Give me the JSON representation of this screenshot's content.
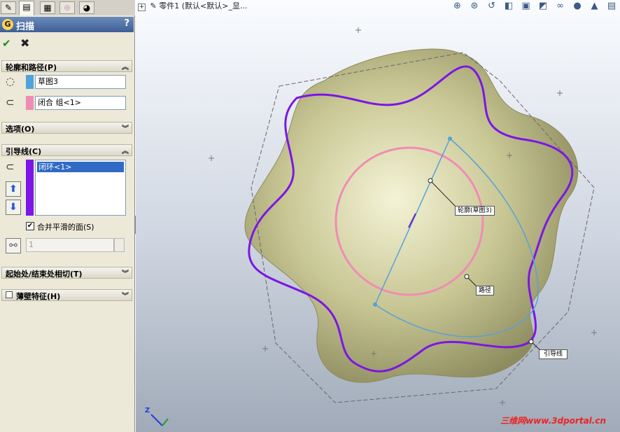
{
  "pm_tabs": [
    {
      "name": "feature-manager-icon",
      "glyph": "✎"
    },
    {
      "name": "property-manager-icon",
      "glyph": "▤"
    },
    {
      "name": "configuration-manager-icon",
      "glyph": "▦"
    },
    {
      "name": "dimxpert-icon",
      "glyph": "⊕"
    },
    {
      "name": "display-manager-icon",
      "glyph": "◕"
    }
  ],
  "feature": {
    "title": "扫描",
    "help": "?",
    "ok": "✔",
    "cancel": "✖"
  },
  "profile_path": {
    "header": "轮廓和路径(P)",
    "profile_value": "草图3",
    "path_value": "闭合 组<1>",
    "profile_color": "#4fa3dc",
    "path_color": "#f08cb4"
  },
  "options": {
    "header": "选项(O)"
  },
  "guides": {
    "header": "引导线(C)",
    "items": [
      "闭环<1>"
    ],
    "color": "#7b16e6",
    "merge_label": "合并平滑的面(S)",
    "merge_checked": true,
    "spin_value": "1"
  },
  "tangency": {
    "header": "起始处/结束处相切(T)"
  },
  "thin": {
    "header": "薄壁特征(H)"
  },
  "graphics": {
    "tree_label": "零件1   (默认<默认>_显...",
    "callouts": {
      "profile": "轮廓(草图3)",
      "path": "路径",
      "guide": "引导线"
    },
    "triad_axis": "Z",
    "watermark": "三维网www.3dportal.cn"
  },
  "view_tools": [
    "zoom-to-fit-icon",
    "zoom-area-icon",
    "previous-view-icon",
    "section-view-icon",
    "view-orientation-icon",
    "display-style-icon",
    "hide-show-icon",
    "edit-appearance-icon",
    "apply-scene-icon",
    "view-settings-icon"
  ]
}
